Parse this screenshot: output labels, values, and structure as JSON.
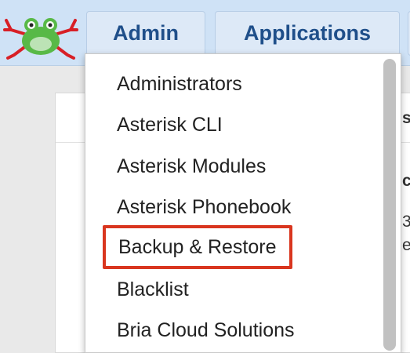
{
  "nav": {
    "logo_icon": "frog-logo-icon",
    "admin_label": "Admin",
    "applications_label": "Applications"
  },
  "menu": {
    "items": [
      {
        "label": "Administrators"
      },
      {
        "label": "Asterisk CLI"
      },
      {
        "label": "Asterisk Modules"
      },
      {
        "label": "Asterisk Phonebook"
      },
      {
        "label": "Backup & Restore",
        "highlighted": true
      },
      {
        "label": "Blacklist"
      },
      {
        "label": "Bria Cloud Solutions"
      }
    ],
    "highlight_color": "#d9361f"
  },
  "page": {
    "peek_1": "s",
    "peek_2": "c",
    "peek_3": "3",
    "peek_4": "e"
  },
  "colors": {
    "navbar_bg": "#cfe2f6",
    "nav_text": "#1f4f8a"
  }
}
